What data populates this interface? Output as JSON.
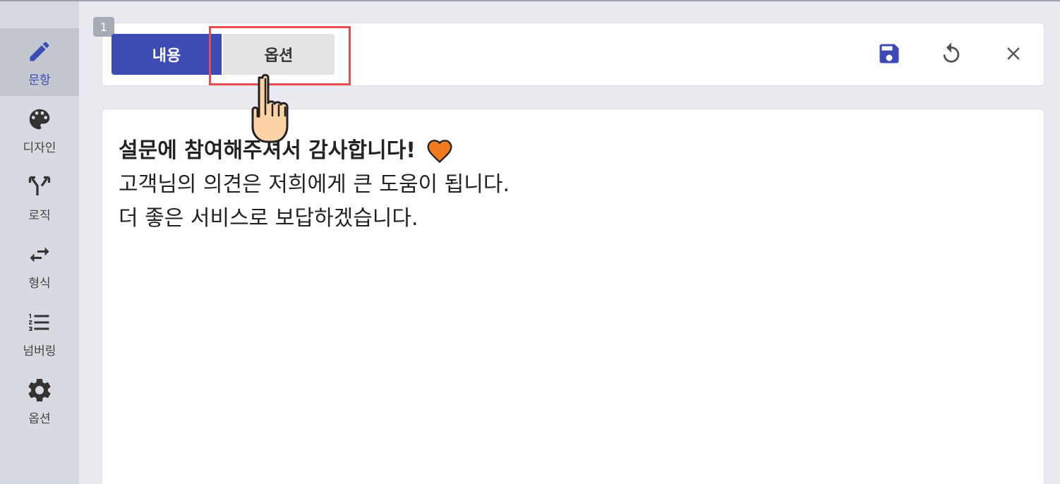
{
  "sidebar": {
    "items": [
      {
        "label": "문항",
        "icon": "pencil-icon",
        "active": true
      },
      {
        "label": "디자인",
        "icon": "palette-icon",
        "active": false
      },
      {
        "label": "로직",
        "icon": "branch-icon",
        "active": false
      },
      {
        "label": "형식",
        "icon": "swap-arrows-icon",
        "active": false
      },
      {
        "label": "넘버링",
        "icon": "numbered-list-icon",
        "active": false
      },
      {
        "label": "옵션",
        "icon": "gear-icon",
        "active": false
      }
    ]
  },
  "toolbar": {
    "question_number": "1",
    "tabs": [
      {
        "label": "내용",
        "active": true
      },
      {
        "label": "옵션",
        "active": false
      }
    ],
    "actions": [
      "save-icon",
      "undo-icon",
      "close-icon"
    ]
  },
  "content": {
    "line1": "설문에 참여해주셔서 감사합니다!",
    "line2": "고객님의 의견은 저희에게 큰 도움이 됩니다.",
    "line3": "더 좋은 서비스로 보답하겠습니다.",
    "emoji": "heart-icon"
  },
  "colors": {
    "accent": "#3d4bb5",
    "highlight": "#ec4b50",
    "heart": "#f07a1e"
  }
}
